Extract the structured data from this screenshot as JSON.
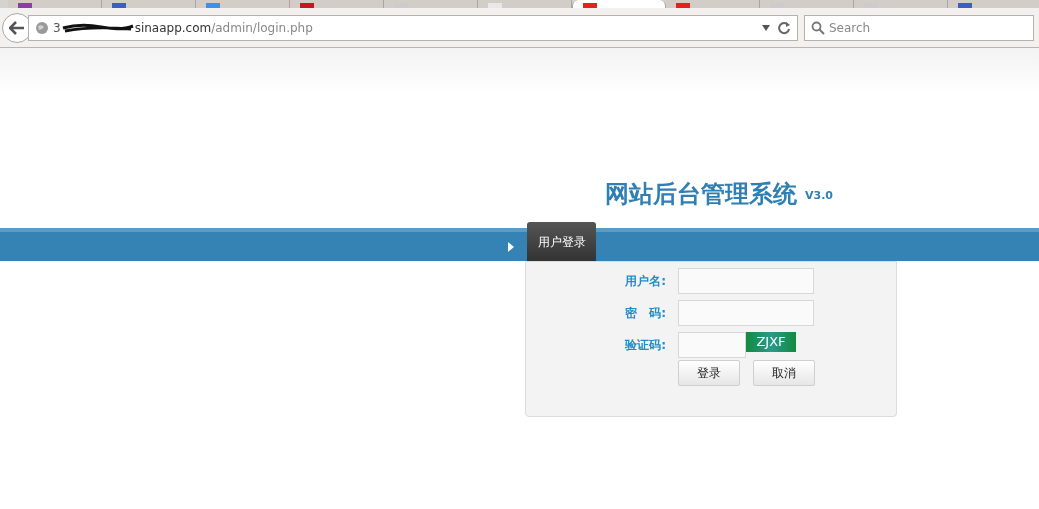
{
  "browser": {
    "tabs": [
      {
        "color": "#8a3fa8",
        "selected": false
      },
      {
        "color": "#3a5fc0",
        "selected": false
      },
      {
        "color": "#3d8fe8",
        "selected": false
      },
      {
        "color": "#c8161e",
        "selected": false
      },
      {
        "color": "#cccccc",
        "selected": false
      },
      {
        "color": "#e8e8e8",
        "selected": false
      },
      {
        "color": "#e8201c",
        "selected": true
      },
      {
        "color": "#e8201c",
        "selected": false
      },
      {
        "color": "#cccccc",
        "selected": false
      },
      {
        "color": "#cccccc",
        "selected": false
      },
      {
        "color": "#3a5fc0",
        "selected": false
      }
    ],
    "address": {
      "prefix": "3",
      "host": "sinaapp.com",
      "path": "/admin/login.php"
    },
    "search": {
      "placeholder": "Search"
    }
  },
  "page": {
    "title": "网站后台管理系统",
    "version": "V3.0",
    "tab": "用户登录",
    "fields": [
      {
        "label": "用户名:",
        "kind": "text"
      },
      {
        "label": "密　码:",
        "kind": "password"
      },
      {
        "label": "验证码:",
        "kind": "captcha",
        "captcha": "ZJXF"
      }
    ],
    "buttons": [
      "登录",
      "取消"
    ]
  }
}
